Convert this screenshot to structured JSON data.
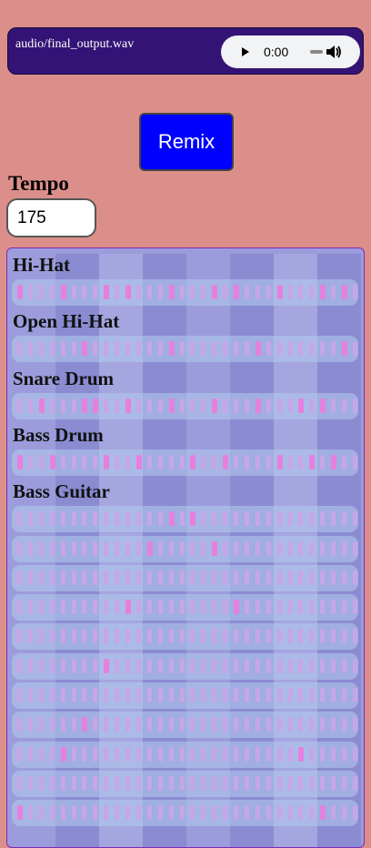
{
  "player": {
    "file_label": "audio/final_output.wav",
    "time": "0:00"
  },
  "remix": {
    "label": "Remix"
  },
  "tempo": {
    "label": "Tempo",
    "value": "175"
  },
  "colors": {
    "background": "#dc8f8a",
    "player_bg": "#331476",
    "remix_bg": "#0000ff",
    "step_on": "#e77fdf",
    "step_off": "#c7a6e8"
  },
  "sequencer": {
    "steps_per_row": 32,
    "tracks": [
      {
        "name": "Hi-Hat",
        "rows": [
          [
            0,
            4,
            8,
            10,
            14,
            18,
            20,
            24,
            28,
            30
          ]
        ]
      },
      {
        "name": "Open Hi-Hat",
        "rows": [
          [
            6,
            14,
            22,
            30
          ]
        ]
      },
      {
        "name": "Snare Drum",
        "rows": [
          [
            2,
            6,
            7,
            10,
            14,
            18,
            22,
            26,
            28
          ]
        ]
      },
      {
        "name": "Bass Drum",
        "rows": [
          [
            0,
            3,
            8,
            11,
            16,
            19,
            24,
            27,
            29
          ]
        ]
      },
      {
        "name": "Bass Guitar",
        "rows": [
          [
            14,
            16
          ],
          [
            12,
            18
          ],
          [],
          [
            10,
            20
          ],
          [],
          [
            8
          ],
          [],
          [
            6
          ],
          [
            4,
            26
          ],
          [],
          [
            0,
            28
          ]
        ]
      }
    ]
  }
}
